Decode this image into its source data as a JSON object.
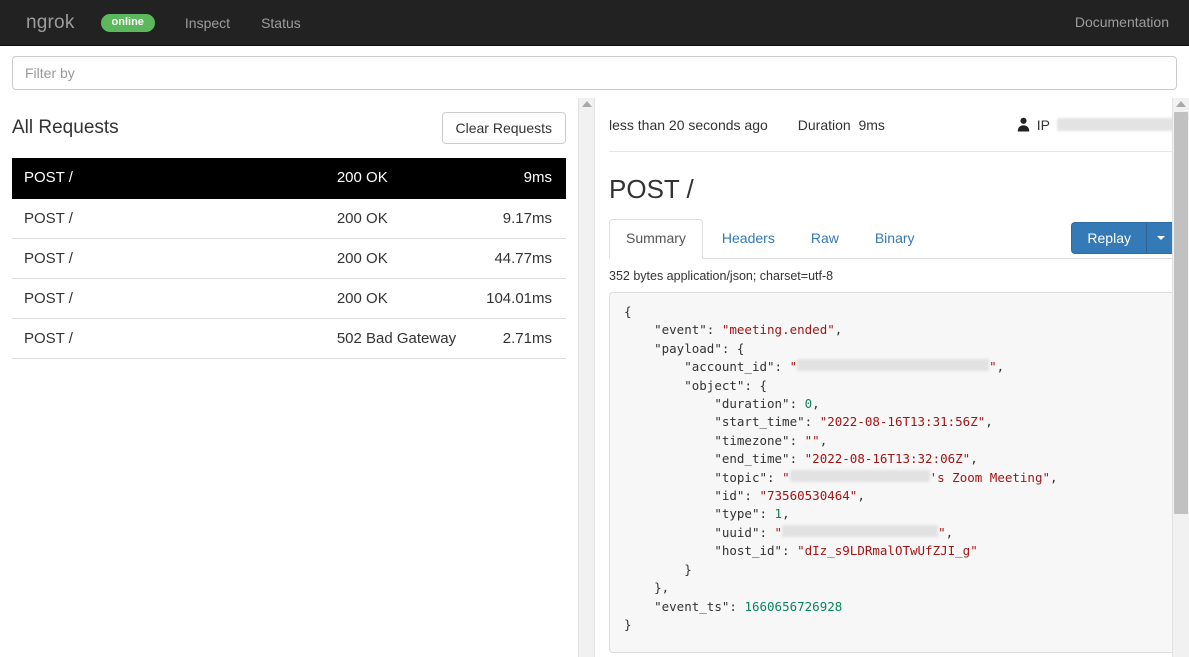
{
  "navbar": {
    "brand": "ngrok",
    "status": "online",
    "links": [
      {
        "label": "Inspect"
      },
      {
        "label": "Status"
      }
    ],
    "right_link": "Documentation",
    "accent_online": "#5cb85c",
    "background": "#222222"
  },
  "filter": {
    "placeholder": "Filter by",
    "value": ""
  },
  "requests_panel": {
    "title": "All Requests",
    "clear_button": "Clear Requests",
    "rows": [
      {
        "method": "POST /",
        "status": "200 OK",
        "duration": "9ms",
        "selected": true
      },
      {
        "method": "POST /",
        "status": "200 OK",
        "duration": "9.17ms",
        "selected": false
      },
      {
        "method": "POST /",
        "status": "200 OK",
        "duration": "44.77ms",
        "selected": false
      },
      {
        "method": "POST /",
        "status": "200 OK",
        "duration": "104.01ms",
        "selected": false
      },
      {
        "method": "POST /",
        "status": "502 Bad Gateway",
        "duration": "2.71ms",
        "selected": false
      }
    ]
  },
  "detail": {
    "time_ago": "less than 20 seconds ago",
    "duration_label": "Duration",
    "duration_value": "9ms",
    "ip_label": "IP",
    "ip_value_redacted": true,
    "title": "POST /",
    "tabs": [
      {
        "label": "Summary",
        "active": true
      },
      {
        "label": "Headers",
        "active": false
      },
      {
        "label": "Raw",
        "active": false
      },
      {
        "label": "Binary",
        "active": false
      }
    ],
    "replay_label": "Replay",
    "body_meta": "352 bytes application/json; charset=utf-8",
    "accent_button": "#337ab7"
  },
  "json_body": {
    "line_01": "{",
    "line_02_key": "\"event\"",
    "line_02_val": "\"meeting.ended\"",
    "line_03_key": "\"payload\"",
    "line_04_key": "\"account_id\"",
    "line_05_key": "\"object\"",
    "line_06_key": "\"duration\"",
    "line_06_val": "0",
    "line_07_key": "\"start_time\"",
    "line_07_val": "\"2022-08-16T13:31:56Z\"",
    "line_08_key": "\"timezone\"",
    "line_08_val": "\"\"",
    "line_09_key": "\"end_time\"",
    "line_09_val": "\"2022-08-16T13:32:06Z\"",
    "line_10_key": "\"topic\"",
    "line_10_val_suffix": "'s Zoom Meeting\"",
    "line_11_key": "\"id\"",
    "line_11_val": "\"73560530464\"",
    "line_12_key": "\"type\"",
    "line_12_val": "1",
    "line_13_key": "\"uuid\"",
    "line_14_key": "\"host_id\"",
    "line_14_val": "\"dIz_s9LDRmalOTwUfZJI_g\"",
    "line_15": "}",
    "line_16": "},",
    "line_17_key": "\"event_ts\"",
    "line_17_val": "1660656726928",
    "line_18": "}"
  }
}
